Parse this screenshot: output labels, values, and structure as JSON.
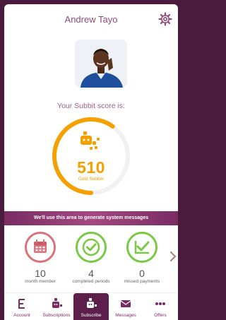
{
  "header": {
    "title": "Andrew Tayo"
  },
  "score": {
    "label": "Your Subbit score is:",
    "value": "510",
    "rank": "Gold Subber",
    "progress": 0.6
  },
  "banner": {
    "text": "We'll use this area to generate system messages"
  },
  "stats": [
    {
      "value": "10",
      "caption": "month member",
      "icon": "calendar-icon"
    },
    {
      "value": "4",
      "caption": "completed periods",
      "icon": "check-circle-icon"
    },
    {
      "value": "0",
      "caption": "missed payments",
      "icon": "check-trend-icon"
    }
  ],
  "tabs": [
    {
      "label": "Account",
      "icon": "account-icon"
    },
    {
      "label": "Subscriptions",
      "icon": "subscriptions-icon"
    },
    {
      "label": "Subscribe",
      "icon": "subscribe-icon",
      "active": true
    },
    {
      "label": "Messages",
      "icon": "messages-icon"
    },
    {
      "label": "Offers",
      "icon": "more-dots-icon"
    }
  ],
  "colors": {
    "brand": "#7a2c62",
    "accent": "#f4a000",
    "green": "#7ac943",
    "coral": "#d9727c"
  }
}
